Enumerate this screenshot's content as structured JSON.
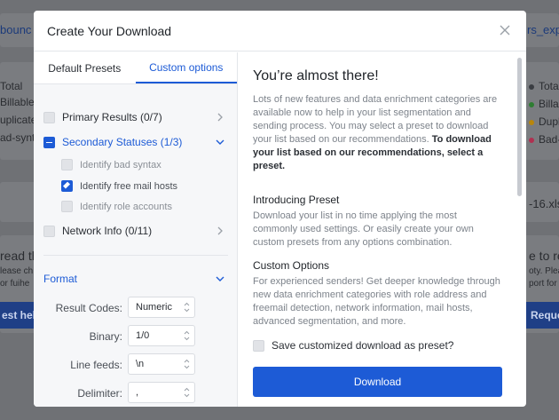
{
  "background": {
    "left_link": "bounc",
    "right_link": "rs_exp",
    "left_items": [
      "Total",
      "Billable",
      "uplicate",
      "ad-synta"
    ],
    "right_items": [
      {
        "label": "Total",
        "color": "#3a3d42"
      },
      {
        "label": "Billab",
        "color": "#2e7d32"
      },
      {
        "label": "Dupli",
        "color": "#b8860b"
      },
      {
        "label": "Bad-s",
        "color": "#b03050"
      }
    ],
    "right_file": "-16.xls",
    "left_heading": "read th",
    "left_sub1": "lease ch",
    "left_sub2": "or fuihe",
    "left_btn": "est help",
    "right_heading": "e to rea",
    "right_sub1": "oty. Plea",
    "right_sub2": "port for",
    "right_btn": "Reques"
  },
  "modal": {
    "title": "Create Your Download",
    "tabs": [
      {
        "label": "Default Presets",
        "active": false
      },
      {
        "label": "Custom options",
        "active": true
      }
    ],
    "groups": {
      "primary": "Primary Results (0/7)",
      "secondary": "Secondary Statuses (1/3)",
      "secondary_items": [
        {
          "label": "Identify bad syntax",
          "checked": false
        },
        {
          "label": "Identify free mail hosts",
          "checked": true
        },
        {
          "label": "Identify role accounts",
          "checked": false
        }
      ],
      "network": "Network Info (0/11)"
    },
    "format": {
      "heading": "Format",
      "fields": [
        {
          "label": "Result Codes:",
          "value": "Numeric"
        },
        {
          "label": "Binary:",
          "value": "1/0"
        },
        {
          "label": "Line feeds:",
          "value": "\\n"
        },
        {
          "label": "Delimiter:",
          "value": ","
        }
      ]
    },
    "right": {
      "title": "You’re almost there!",
      "intro_plain": "Lots of new features and data enrichment categories are available now to help in your list segmentation and sending process. You may select a preset to download your list based on our recommendations.",
      "intro_bold": "To download your list based on our recommendations, select a preset.",
      "preset_heading": "Introducing Preset",
      "preset_text": "Download your list in no time applying the most commonly used settings. Or easily create your own custom presets from any options combination.",
      "custom_heading": "Custom Options",
      "custom_text": "For experienced senders! Get deeper knowledge through new data enrichment categories with role address and freemail detection, network information, mail hosts, advanced segmentation, and more.",
      "save_label": "Save customized download as preset?",
      "download_label": "Download"
    },
    "colors": {
      "accent": "#1d5bd6"
    }
  }
}
